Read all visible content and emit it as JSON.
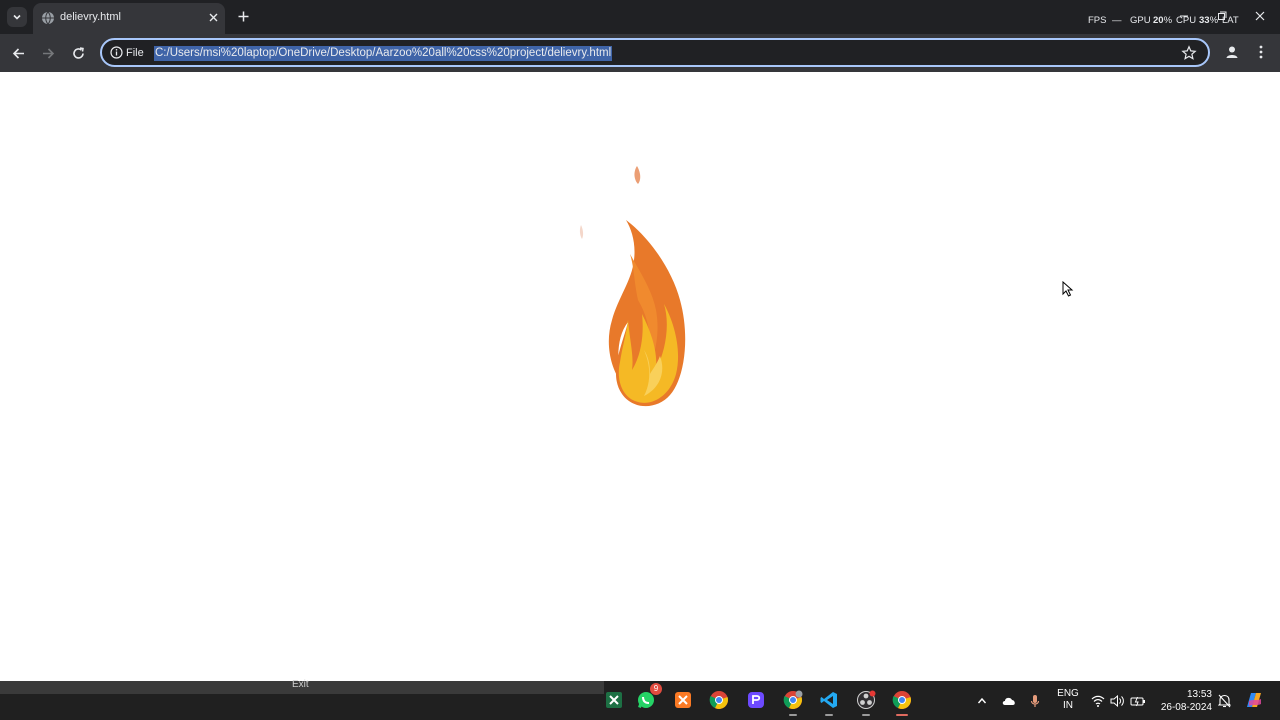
{
  "browser": {
    "tab": {
      "title": "delievry.html"
    },
    "perf_overlay": {
      "fps_label": "FPS",
      "fps_value": "—",
      "gpu_label": "GPU",
      "gpu_value": "20",
      "gpu_unit": "%",
      "cpu_label": "CPU",
      "cpu_value": "33",
      "cpu_unit": "%",
      "lat_label": "LAT"
    },
    "omnibox": {
      "chip": "File",
      "url": "C:/Users/msi%20laptop/OneDrive/Desktop/Aarzoo%20all%20css%20project/delievry.html"
    }
  },
  "page": {
    "illustration": "flame"
  },
  "taskbar": {
    "overlay_label": "Exit",
    "apps": [
      {
        "name": "excel",
        "badge": ""
      },
      {
        "name": "whatsapp",
        "badge": "9"
      },
      {
        "name": "xampp",
        "badge": ""
      },
      {
        "name": "chrome",
        "badge": ""
      },
      {
        "name": "proton",
        "badge": ""
      },
      {
        "name": "chrome-profile",
        "badge": ""
      },
      {
        "name": "vscode",
        "badge": ""
      },
      {
        "name": "obs",
        "badge": ""
      },
      {
        "name": "chrome-active",
        "badge": ""
      }
    ],
    "language": {
      "line1": "ENG",
      "line2": "IN"
    },
    "clock": {
      "time": "13:53",
      "date": "26-08-2024"
    }
  },
  "colors": {
    "tabstrip": "#202124",
    "toolbar": "#35363a",
    "omnibox_border": "#a8c7fa",
    "url_selection": "#3f64a8",
    "flame_outer": "#e8792a",
    "flame_inner": "#f5b925",
    "taskbar": "#202020"
  }
}
